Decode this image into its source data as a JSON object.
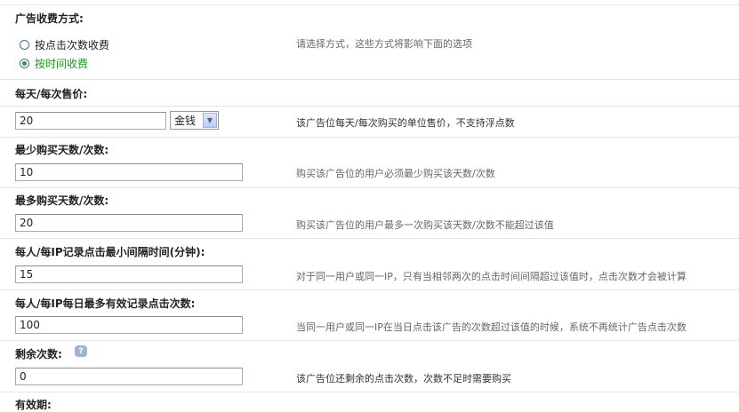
{
  "billing": {
    "label": "广告收费方式:",
    "options": [
      {
        "label": "按点击次数收费",
        "selected": false
      },
      {
        "label": "按时间收费",
        "selected": true
      }
    ],
    "hint": "请选择方式，这些方式将影响下面的选项"
  },
  "price": {
    "label": "每天/每次售价:",
    "value": "20",
    "currency": "金钱",
    "hint": "该广告位每天/每次购买的单位售价，不支持浮点数"
  },
  "min_days": {
    "label": "最少购买天数/次数:",
    "value": "10",
    "hint": "购买该广告位的用户必须最少购买该天数/次数"
  },
  "max_days": {
    "label": "最多购买天数/次数:",
    "value": "20",
    "hint": "购买该广告位的用户最多一次购买该天数/次数不能超过该值"
  },
  "click_interval": {
    "label": "每人/每IP记录点击最小间隔时间(分钟):",
    "value": "15",
    "hint": "对于同一用户或同一IP，只有当相邻两次的点击时间间隔超过该值时，点击次数才会被计算"
  },
  "daily_clicks": {
    "label": "每人/每IP每日最多有效记录点击次数:",
    "value": "100",
    "hint": "当同一用户或同一IP在当日点击该广告的次数超过该值的时候，系统不再统计广告点击次数"
  },
  "remaining": {
    "label": "剩余次数:",
    "help_icon": "?",
    "value": "0",
    "hint": "该广告位还剩余的点击次数，次数不足时需要购买"
  },
  "validity": {
    "label": "有效期:"
  },
  "colors": {
    "selected_option": "#1c9a1c",
    "help_icon": "#9fb3cf"
  }
}
